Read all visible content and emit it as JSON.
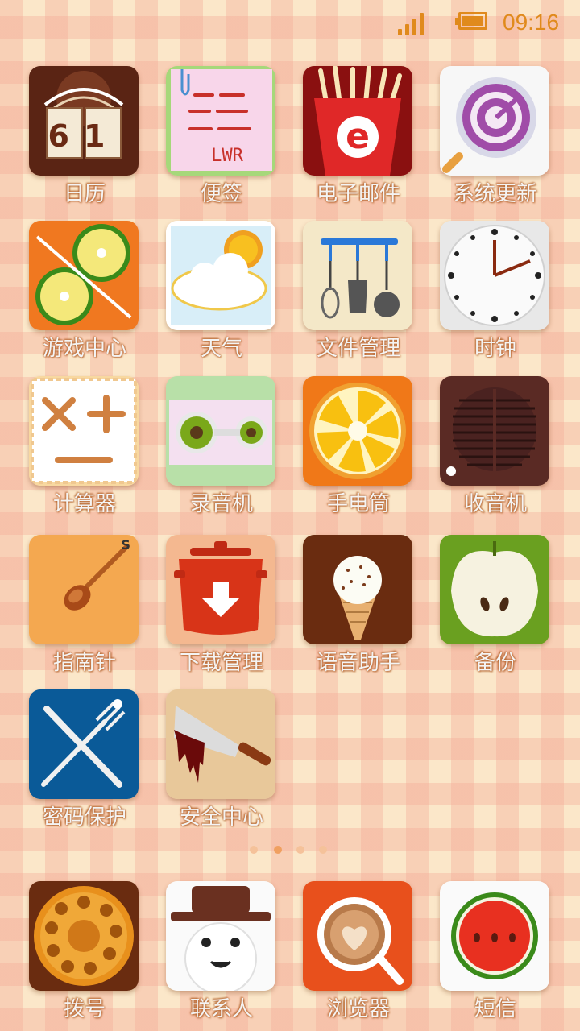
{
  "status_bar": {
    "time": "09:16",
    "signal_icon": "signal-icon",
    "battery_icon": "battery-icon"
  },
  "apps": [
    {
      "label": "日历",
      "icon": "calendar-icon"
    },
    {
      "label": "便签",
      "icon": "notes-icon"
    },
    {
      "label": "电子邮件",
      "icon": "email-icon"
    },
    {
      "label": "系统更新",
      "icon": "system-update-icon"
    },
    {
      "label": "游戏中心",
      "icon": "game-center-icon"
    },
    {
      "label": "天气",
      "icon": "weather-icon"
    },
    {
      "label": "文件管理",
      "icon": "file-manager-icon"
    },
    {
      "label": "时钟",
      "icon": "clock-icon"
    },
    {
      "label": "计算器",
      "icon": "calculator-icon"
    },
    {
      "label": "录音机",
      "icon": "recorder-icon"
    },
    {
      "label": "手电筒",
      "icon": "flashlight-icon"
    },
    {
      "label": "收音机",
      "icon": "radio-icon"
    },
    {
      "label": "指南针",
      "icon": "compass-icon"
    },
    {
      "label": "下载管理",
      "icon": "download-manager-icon"
    },
    {
      "label": "语音助手",
      "icon": "voice-assistant-icon"
    },
    {
      "label": "备份",
      "icon": "backup-icon"
    },
    {
      "label": "密码保护",
      "icon": "password-protection-icon"
    },
    {
      "label": "安全中心",
      "icon": "security-center-icon"
    }
  ],
  "calendar_text": "61",
  "notes_text": "LWR",
  "email_text": "e",
  "compass_text": "S",
  "page_indicator": {
    "count": 4,
    "active_index": 1
  },
  "dock": [
    {
      "label": "拨号",
      "icon": "dialer-icon"
    },
    {
      "label": "联系人",
      "icon": "contacts-icon"
    },
    {
      "label": "浏览器",
      "icon": "browser-icon"
    },
    {
      "label": "短信",
      "icon": "messages-icon"
    }
  ],
  "colors": {
    "accent": "#e08a1c",
    "label_shadow": "#c0703a"
  }
}
